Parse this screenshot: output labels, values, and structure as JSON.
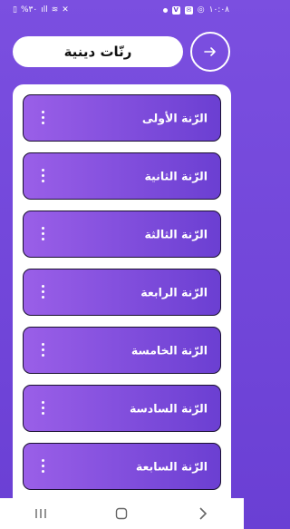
{
  "status_bar": {
    "time": "١٠:٠٨",
    "battery": "%٣٠",
    "signal_icon": "signal-icon",
    "wifi_icon": "wifi-icon"
  },
  "header": {
    "title": "رنّات دينية",
    "forward_icon": "arrow-right-icon"
  },
  "ringtones": [
    {
      "label": "الرّنة الأولى"
    },
    {
      "label": "الرّنة الثانية"
    },
    {
      "label": "الرّنة الثالثة"
    },
    {
      "label": "الرّنة الرابعة"
    },
    {
      "label": "الرّنة الخامسة"
    },
    {
      "label": "الرّنة السادسة"
    },
    {
      "label": "الرّنة السابعة"
    }
  ],
  "colors": {
    "background": "#6a3fd4",
    "item_start": "#9a5fe8",
    "item_end": "#6b3fd2"
  }
}
